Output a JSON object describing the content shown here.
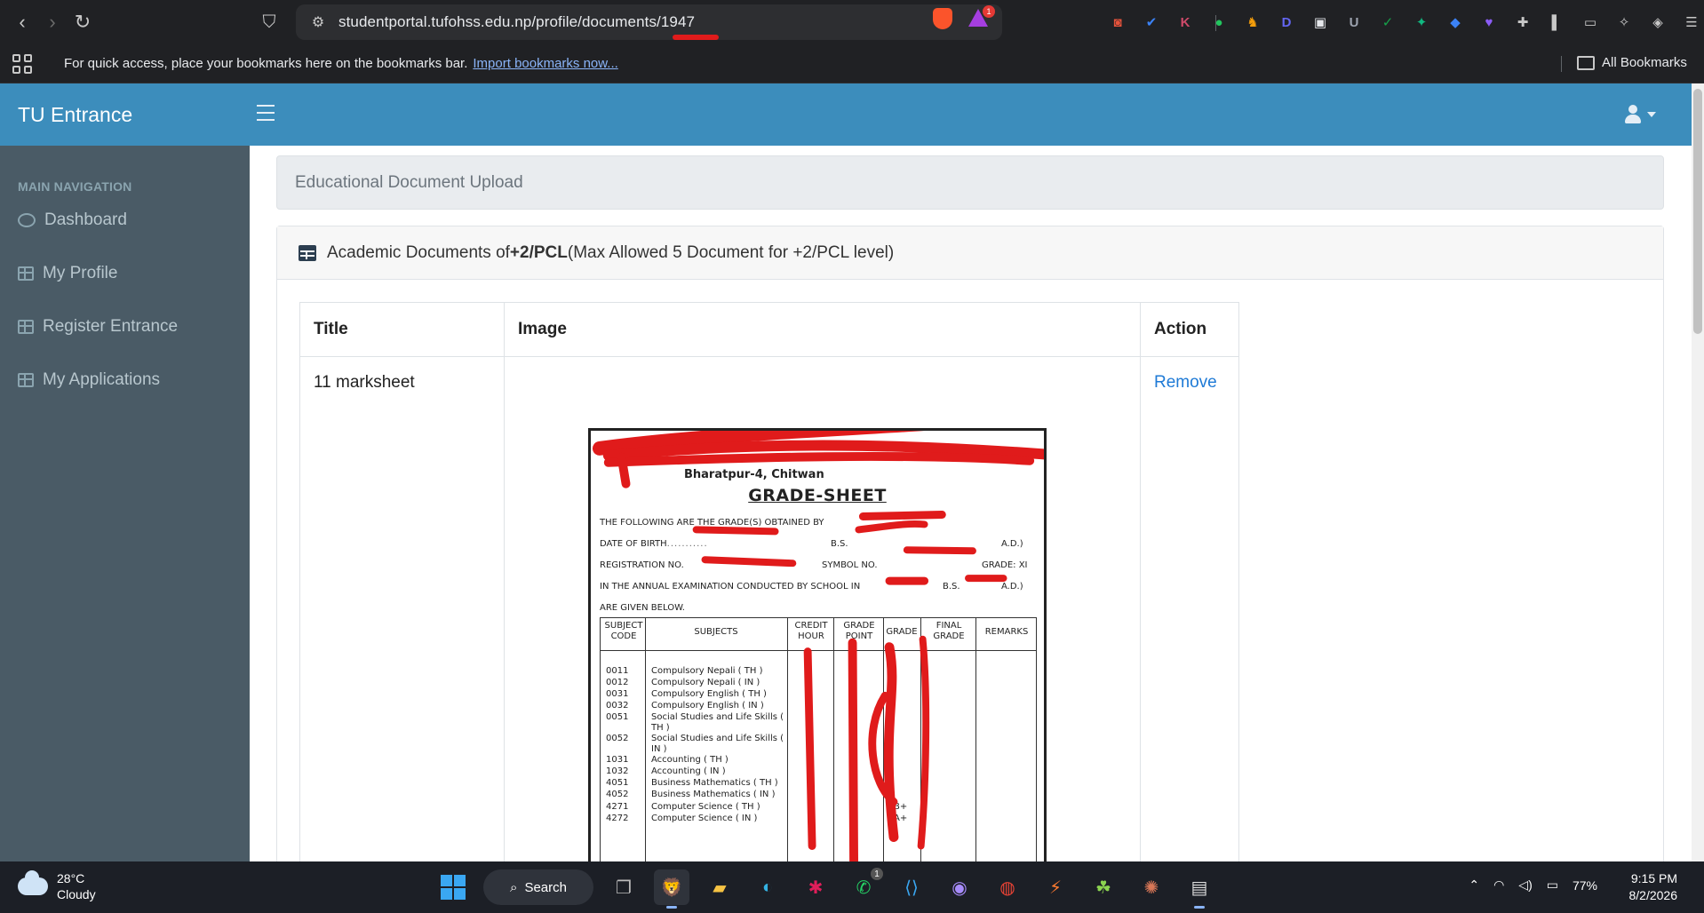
{
  "browser": {
    "url": "studentportal.tufohss.edu.np/profile/documents/1947",
    "rewards_badge": "1",
    "extensions": [
      {
        "name": "ext-1-icon",
        "glyph": "◙",
        "color": "#e5533c"
      },
      {
        "name": "ext-2-icon",
        "glyph": "✔",
        "color": "#3b82f6"
      },
      {
        "name": "ext-3-icon",
        "glyph": "K",
        "color": "#d04a6a"
      },
      {
        "name": "ext-4-icon",
        "glyph": "●",
        "color": "#22c55e"
      },
      {
        "name": "ext-5-icon",
        "glyph": "♞",
        "color": "#f59e0b"
      },
      {
        "name": "ext-6-icon",
        "glyph": "D",
        "color": "#6366f1"
      },
      {
        "name": "ext-7-icon",
        "glyph": "▣",
        "color": "#e5e7eb"
      },
      {
        "name": "ext-8-icon",
        "glyph": "U",
        "color": "#9ca3af"
      },
      {
        "name": "ext-9-icon",
        "glyph": "✓",
        "color": "#16a34a"
      },
      {
        "name": "ext-10-icon",
        "glyph": "✦",
        "color": "#10b981"
      },
      {
        "name": "ext-11-icon",
        "glyph": "◆",
        "color": "#3b82f6"
      },
      {
        "name": "ext-12-icon",
        "glyph": "♥",
        "color": "#8b5cf6"
      },
      {
        "name": "puzzle-icon",
        "glyph": "✚",
        "color": "#c8c8c8"
      },
      {
        "name": "sidebar-toggle-icon",
        "glyph": "▌",
        "color": "#c8c8c8"
      },
      {
        "name": "wallet-icon",
        "glyph": "▭",
        "color": "#c8c8c8"
      },
      {
        "name": "leo-icon",
        "glyph": "✧",
        "color": "#c8c8c8"
      },
      {
        "name": "vpn-icon",
        "glyph": "◈",
        "color": "#c8c8c8"
      },
      {
        "name": "menu-icon",
        "glyph": "☰",
        "color": "#c8c8c8"
      }
    ]
  },
  "bookmarks_bar": {
    "message": "For quick access, place your bookmarks here on the bookmarks bar.",
    "import_link": "Import bookmarks now...",
    "all_bookmarks": "All Bookmarks"
  },
  "app": {
    "brand": "TU Entrance",
    "accent_color": "#3c8dbc"
  },
  "sidebar": {
    "header": "MAIN NAVIGATION",
    "items": [
      {
        "label": "Dashboard",
        "icon": "dashboard-icon"
      },
      {
        "label": "My Profile",
        "icon": "table-icon"
      },
      {
        "label": "Register Entrance",
        "icon": "table-icon"
      },
      {
        "label": "My Applications",
        "icon": "table-icon"
      }
    ]
  },
  "main": {
    "breadcrumb": "Educational Document Upload",
    "card": {
      "prefix": "Academic Documents of ",
      "level": "+2/PCL",
      "suffix": "(Max Allowed 5 Document for +2/PCL level)"
    },
    "table": {
      "headers": [
        "Title",
        "Image",
        "Action"
      ],
      "rows": [
        {
          "title": "11 marksheet",
          "action": "Remove"
        }
      ]
    }
  },
  "document_image": {
    "address": "Bharatpur-4, Chitwan",
    "heading": "GRADE-SHEET",
    "lines": [
      "THE FOLLOWING ARE THE GRADE(S) OBTAINED BY",
      "DATE OF BIRTH",
      "B.S.",
      "A.D.)",
      "REGISTRATION NO.",
      "SYMBOL NO.",
      "GRADE: XI",
      "IN THE ANNUAL EXAMINATION CONDUCTED BY SCHOOL IN",
      "B.S.",
      "A.D.)",
      "ARE GIVEN BELOW."
    ],
    "columns": [
      "SUBJECT CODE",
      "SUBJECTS",
      "CREDIT HOUR",
      "GRADE POINT",
      "GRADE",
      "FINAL GRADE",
      "REMARKS"
    ],
    "subjects": [
      {
        "code": "0011",
        "name": "Compulsory Nepali ( TH )"
      },
      {
        "code": "0012",
        "name": "Compulsory Nepali ( IN )"
      },
      {
        "code": "0031",
        "name": "Compulsory English ( TH )"
      },
      {
        "code": "0032",
        "name": "Compulsory English ( IN )"
      },
      {
        "code": "0051",
        "name": "Social Studies and Life Skills ( TH )"
      },
      {
        "code": "0052",
        "name": "Social Studies and Life Skills ( IN )"
      },
      {
        "code": "1031",
        "name": "Accounting ( TH )"
      },
      {
        "code": "1032",
        "name": "Accounting ( IN )"
      },
      {
        "code": "4051",
        "name": "Business Mathematics ( TH )"
      },
      {
        "code": "4052",
        "name": "Business Mathematics ( IN )"
      },
      {
        "code": "4271",
        "name": "Computer Science ( TH )"
      },
      {
        "code": "4272",
        "name": "Computer Science ( IN )"
      }
    ],
    "visible_grades": [
      "B+",
      "A+"
    ]
  },
  "taskbar": {
    "temperature": "28°C",
    "condition": "Cloudy",
    "search_label": "Search",
    "whatsapp_badge": "1",
    "battery": "77%",
    "time": "9:15 PM",
    "date": "8/2/2026"
  }
}
